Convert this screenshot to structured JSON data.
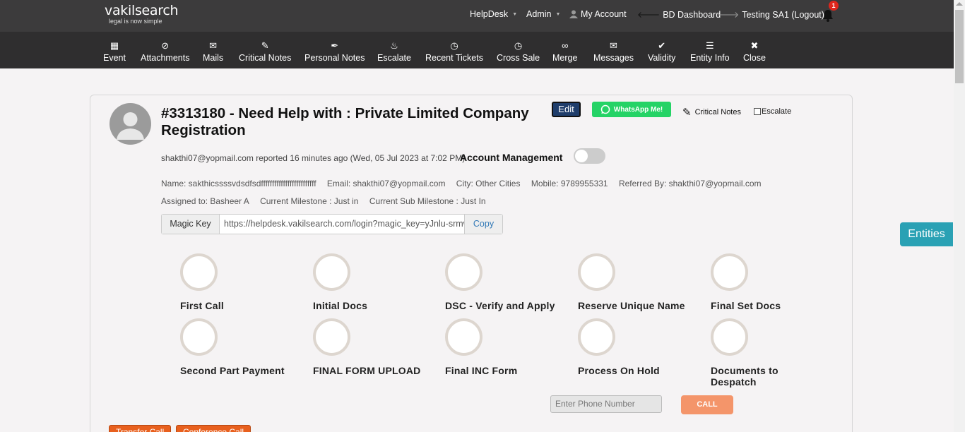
{
  "logo": {
    "name": "vakilsearch",
    "tagline": "legal is now simple"
  },
  "topnav": {
    "helpdesk": "HelpDesk",
    "admin": "Admin",
    "my_account": "My Account",
    "bd_dashboard": "BD Dashboard",
    "logout": "Testing SA1 (Logout)",
    "notification_count": "1"
  },
  "toolbar": [
    {
      "label": "Event",
      "icon": "calendar-icon"
    },
    {
      "label": "Attachments",
      "icon": "paperclip-icon"
    },
    {
      "label": "Mails",
      "icon": "envelope-icon"
    },
    {
      "label": "Critical Notes",
      "icon": "pencil-icon"
    },
    {
      "label": "Personal Notes",
      "icon": "pushpin-icon"
    },
    {
      "label": "Escalate",
      "icon": "fire-icon"
    },
    {
      "label": "Recent Tickets",
      "icon": "clock-icon"
    },
    {
      "label": "Cross Sale",
      "icon": "clock-icon"
    },
    {
      "label": "Merge",
      "icon": "link-icon"
    },
    {
      "label": "Messages",
      "icon": "envelope-icon"
    },
    {
      "label": "Validity",
      "icon": "check-icon"
    },
    {
      "label": "Entity Info",
      "icon": "list-icon"
    },
    {
      "label": "Close",
      "icon": "close-icon"
    }
  ],
  "ticket": {
    "title": "#3313180 - Need Help with : Private Limited Company Registration",
    "edit_label": "Edit",
    "whatsapp_label": "WhatsApp Me!",
    "critical_notes_label": "Critical Notes",
    "escalate_label": "Escalate",
    "reported": "shakthi07@yopmail.com reported 16 minutes ago (Wed, 05 Jul 2023 at 7:02 PM)",
    "account_management_label": "Account Management",
    "account_management_on": false,
    "name": "Name: sakthicssssvdsdfsdfffffffffffffffffffffffff",
    "email": "Email: shakthi07@yopmail.com",
    "city": "City: Other Cities",
    "mobile": "Mobile: 9789955331",
    "referred_by": "Referred By: shakthi07@yopmail.com",
    "assigned_to": "Assigned to: Basheer A",
    "current_milestone": "Current Milestone : Just in",
    "current_sub_milestone": "Current Sub Milestone : Just In"
  },
  "magic_key": {
    "label": "Magic Key",
    "value": "https://helpdesk.vakilsearch.com/login?magic_key=yJnlu-srmwg",
    "copy_label": "Copy"
  },
  "milestones": [
    "First Call",
    "Initial Docs",
    "DSC - Verify and Apply",
    "Reserve Unique Name",
    "Final Set Docs",
    "Second Part Payment",
    "FINAL FORM UPLOAD",
    "Final INC Form",
    "Process On Hold",
    "Documents to Despatch"
  ],
  "call": {
    "phone_placeholder": "Enter Phone Number",
    "call_label": "CALL"
  },
  "entities_label": "Entities",
  "bottom_buttons": {
    "transfer": "Transfer Call",
    "conference": "Conference Call"
  },
  "colors": {
    "toolbar": "#2f2e2f",
    "topbar": "#3c3b3c",
    "whatsapp": "#25d366",
    "entities": "#2aa1b4",
    "call": "#f4956a",
    "orange": "#e8601e"
  }
}
